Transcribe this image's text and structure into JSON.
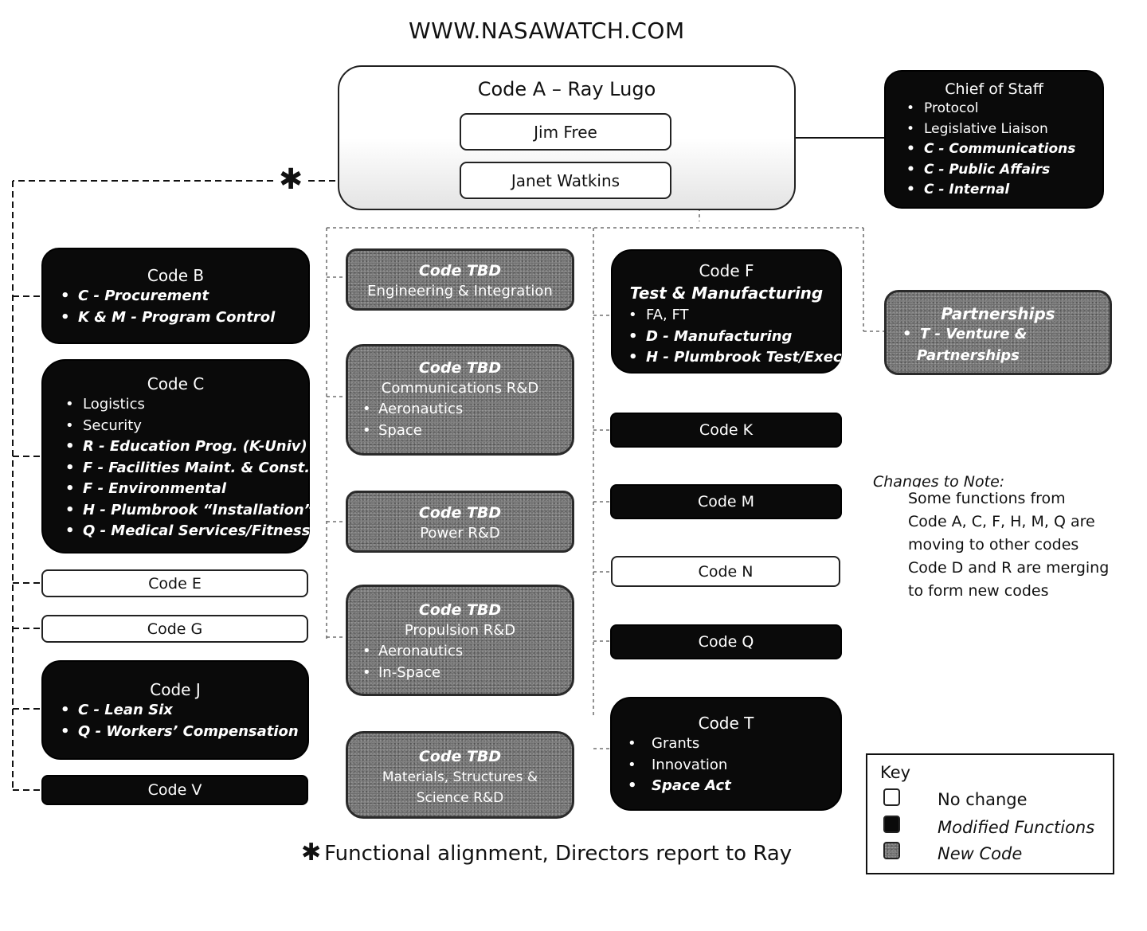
{
  "watermark": "WWW.NASAWATCH.COM",
  "code_a": {
    "title": "Code A – Ray Lugo",
    "people": [
      "Jim Free",
      "Janet Watkins"
    ]
  },
  "chief_of_staff": {
    "title": "Chief of Staff",
    "items": [
      {
        "text": "Protocol",
        "modified": false
      },
      {
        "text": "Legislative Liaison",
        "modified": false
      },
      {
        "text": "C - Communications",
        "modified": true
      },
      {
        "text": "C - Public Affairs",
        "modified": true
      },
      {
        "text": "C - Internal",
        "modified": true
      }
    ]
  },
  "left_column": {
    "code_b": {
      "title": "Code B",
      "items": [
        {
          "text": "C - Procurement",
          "modified": true
        },
        {
          "text": "K & M - Program Control",
          "modified": true
        }
      ]
    },
    "code_c": {
      "title": "Code C",
      "items": [
        {
          "text": "Logistics",
          "modified": false
        },
        {
          "text": "Security",
          "modified": false
        },
        {
          "text": "R - Education Prog. (K-Univ)",
          "modified": true
        },
        {
          "text": "F - Facilities Maint. & Const.",
          "modified": true
        },
        {
          "text": "F - Environmental",
          "modified": true
        },
        {
          "text": "H - Plumbrook “Installation”",
          "modified": true
        },
        {
          "text": "Q - Medical Services/Fitness",
          "modified": true
        }
      ]
    },
    "code_e": {
      "title": "Code E"
    },
    "code_g": {
      "title": "Code G"
    },
    "code_j": {
      "title": "Code J",
      "items": [
        {
          "text": "C - Lean Six",
          "modified": true
        },
        {
          "text": "Q - Workers’ Compensation",
          "modified": true
        }
      ]
    },
    "code_v": {
      "title": "Code V"
    }
  },
  "middle_column": [
    {
      "title": "Code TBD",
      "subtitle": "Engineering & Integration",
      "items": []
    },
    {
      "title": "Code TBD",
      "subtitle": "Communications R&D",
      "items": [
        "Aeronautics",
        "Space"
      ]
    },
    {
      "title": "Code TBD",
      "subtitle": "Power R&D",
      "items": []
    },
    {
      "title": "Code TBD",
      "subtitle": "Propulsion R&D",
      "items": [
        "Aeronautics",
        "In-Space"
      ]
    },
    {
      "title": "Code TBD",
      "subtitle": "Materials, Structures &",
      "subtitle2": "Science R&D",
      "items": []
    }
  ],
  "right_column": {
    "code_f": {
      "title": "Code F",
      "subtitle": "Test & Manufacturing",
      "items": [
        {
          "text": "FA, FT",
          "modified": false
        },
        {
          "text": "D - Manufacturing",
          "modified": true
        },
        {
          "text": "H - Plumbrook Test/Exec",
          "modified": true
        }
      ]
    },
    "code_k": {
      "title": "Code K"
    },
    "code_m": {
      "title": "Code M"
    },
    "code_n": {
      "title": "Code N"
    },
    "code_q": {
      "title": "Code Q"
    },
    "code_t": {
      "title": "Code T",
      "items": [
        {
          "text": "Grants",
          "modified": false
        },
        {
          "text": "Innovation",
          "modified": false
        },
        {
          "text": "Space Act",
          "modified": true
        }
      ]
    }
  },
  "partnerships": {
    "title": "Partnerships",
    "items": [
      {
        "text": "T - Venture &",
        "modified": true
      }
    ],
    "continuation": "Partnerships"
  },
  "notes": {
    "heading": "Changes to Note:",
    "lines": [
      "Some functions from",
      "Code A, C, F, H, M, Q are",
      "moving to other codes",
      "Code D and R are merging",
      "to form new codes"
    ]
  },
  "key": {
    "title": "Key",
    "entries": [
      {
        "label": "No change",
        "style": "white",
        "italic": false
      },
      {
        "label": "Modified Functions",
        "style": "black",
        "italic": true
      },
      {
        "label": "New Code",
        "style": "grey",
        "italic": true
      }
    ]
  },
  "footnote": {
    "symbol": "✱",
    "text": "Functional alignment, Directors report to Ray"
  },
  "asterisk_marker": "✱"
}
